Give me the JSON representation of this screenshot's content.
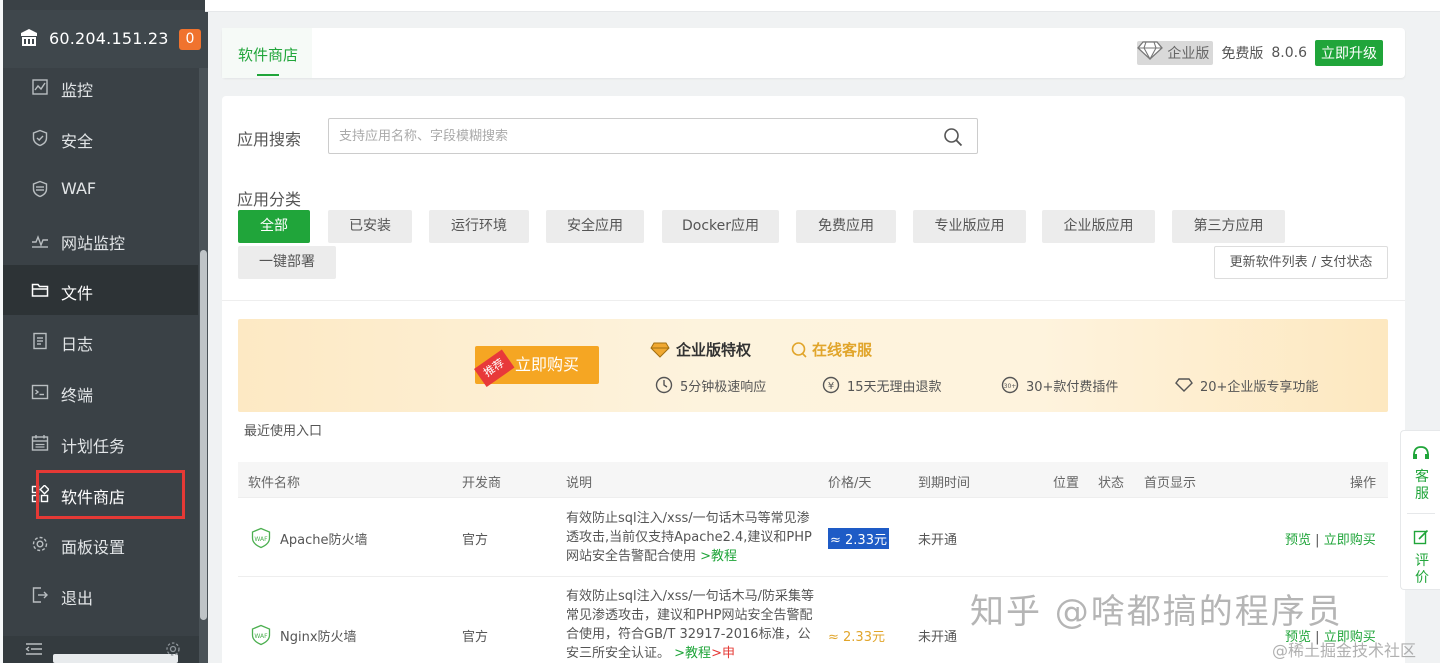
{
  "sidebar": {
    "server_ip": "60.204.151.23",
    "badge_count": "0",
    "items": [
      {
        "label": "监控",
        "icon": "monitor-icon"
      },
      {
        "label": "安全",
        "icon": "shield-icon"
      },
      {
        "label": "WAF",
        "icon": "waf-shield-icon"
      },
      {
        "label": "网站监控",
        "icon": "site-monitor-icon"
      },
      {
        "label": "文件",
        "icon": "folder-icon"
      },
      {
        "label": "日志",
        "icon": "log-icon"
      },
      {
        "label": "终端",
        "icon": "terminal-icon"
      },
      {
        "label": "计划任务",
        "icon": "calendar-icon"
      },
      {
        "label": "软件商店",
        "icon": "app-store-icon"
      },
      {
        "label": "面板设置",
        "icon": "gear-icon"
      },
      {
        "label": "退出",
        "icon": "logout-icon"
      }
    ],
    "active_item": "文件"
  },
  "tabs": {
    "active_tab": "软件商店"
  },
  "version": {
    "edition_tag": "企业版",
    "free_label": "免费版",
    "version": "8.0.6",
    "upgrade_label": "立即升级"
  },
  "search": {
    "label": "应用搜索",
    "placeholder": "支持应用名称、字段模糊搜索",
    "value": ""
  },
  "categories": {
    "label": "应用分类",
    "items": [
      "全部",
      "已安装",
      "运行环境",
      "安全应用",
      "Docker应用",
      "免费应用",
      "专业版应用",
      "企业版应用",
      "第三方应用",
      "一键部署"
    ],
    "selected": "全部",
    "refresh_label": "更新软件列表 / 支付状态"
  },
  "banner": {
    "tag": "推荐",
    "buy_label": "立即购买",
    "ent_privilege": "企业版特权",
    "online_service": "在线客服",
    "features": [
      "5分钟极速响应",
      "15天无理由退款",
      "30+款付费插件",
      "20+企业版专享功能"
    ]
  },
  "recent_label": "最近使用入口",
  "table": {
    "headers": [
      "软件名称",
      "开发商",
      "说明",
      "价格/天",
      "到期时间",
      "位置",
      "状态",
      "首页显示",
      "操作"
    ],
    "rows": [
      {
        "name": "Apache防火墙",
        "vendor": "官方",
        "desc": "有效防止sql注入/xss/一句话木马等常见渗透攻击,当前仅支持Apache2.4,建议和PHP网站安全告警配合使用",
        "tutorial": ">教程",
        "apply": "",
        "price": "≈ 2.33元",
        "expire": "未开通",
        "preview": "预览",
        "buy": "立即购买"
      },
      {
        "name": "Nginx防火墙",
        "vendor": "官方",
        "desc": "有效防止sql注入/xss/一句话木马/防采集等常见渗透攻击，建议和PHP网站安全告警配合使用，符合GB/T 32917-2016标准，公安三所安全认证。",
        "tutorial": ">教程",
        "apply": ">申",
        "price": "≈ 2.33元",
        "expire": "未开通",
        "preview": "预览",
        "buy": "立即购买"
      }
    ]
  },
  "float_panel": {
    "service": "客服",
    "review": "评价"
  },
  "watermark": {
    "main": "知乎 @啥都搞的程序员",
    "sub": "@稀土掘金技术社区"
  },
  "colors": {
    "accent": "#20a53a",
    "sidebar_bg": "#3a4146",
    "badge": "#f0732e",
    "price": "#e1a52b",
    "highlight": "#e53935"
  }
}
